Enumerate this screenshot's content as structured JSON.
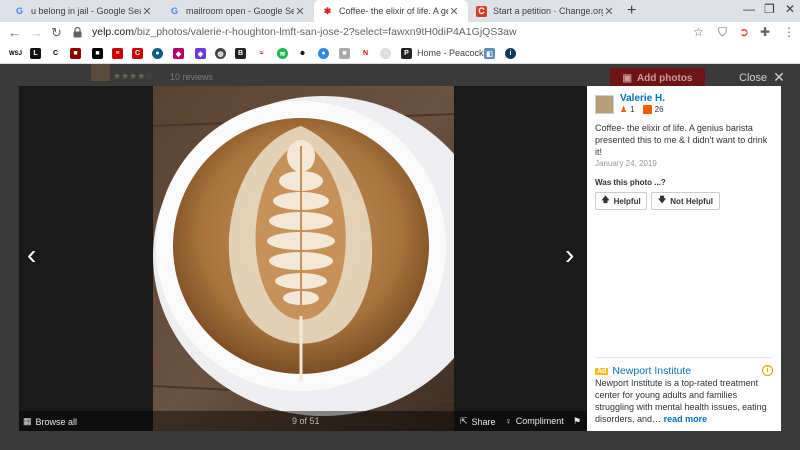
{
  "tabs": [
    {
      "title": "u belong in jail - Google Search",
      "favicon": "google-g",
      "active": false
    },
    {
      "title": "mailroom open - Google Search",
      "favicon": "google-g",
      "active": false
    },
    {
      "title": "Coffee- the elixir of life. A genius",
      "favicon": "yelp-burst",
      "active": true
    },
    {
      "title": "Start a petition · Change.org",
      "favicon": "change-org-c",
      "active": false
    }
  ],
  "toolbar": {
    "url_host": "yelp.com",
    "url_path": "/biz_photos/valerie-r-houghton-lmft-san-jose-2?select=fawxn9tH0diP4A1GjQS3aw"
  },
  "bookmarks": {
    "peacock_label": "Home - Peacock"
  },
  "background": {
    "reviews_text": "10 reviews",
    "add_photos_label": "Add photos",
    "close_label": "Close"
  },
  "viewer": {
    "browse_all": "Browse all",
    "counter": "9 of 51",
    "share": "Share",
    "compliment": "Compliment"
  },
  "photo_panel": {
    "user_name": "Valerie H.",
    "friends_count": "1",
    "reviews_count": "26",
    "caption": "Coffee- the elixir of life. A genius barista presented this to me & I didn't want to drink it!",
    "date": "January 24, 2019",
    "helpful_question": "Was this photo ...?",
    "helpful_label": "Helpful",
    "not_helpful_label": "Not Helpful"
  },
  "ad": {
    "badge": "Ad",
    "name": "Newport Institute",
    "body": "Newport Institute is a top-rated treatment center for young adults and families struggling with mental health issues, eating disorders, and…",
    "read_more": "read more"
  },
  "colors": {
    "yelp_red": "#d32323",
    "link_blue": "#0073bb",
    "ad_yellow": "#f5be00"
  }
}
